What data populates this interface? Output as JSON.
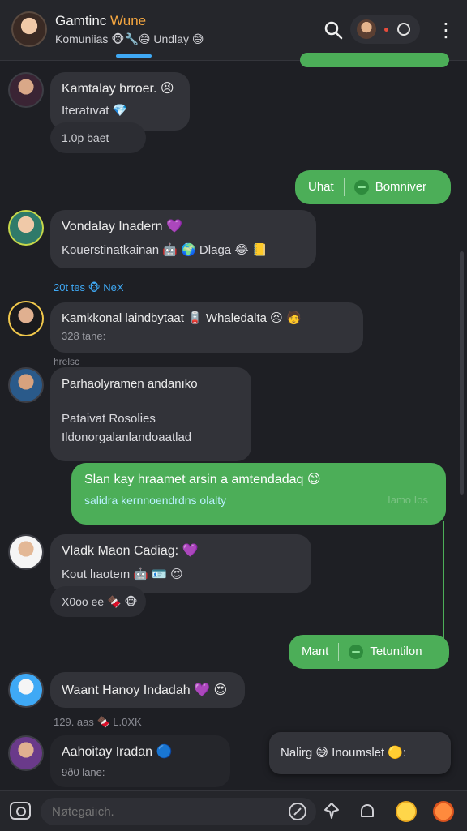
{
  "header": {
    "title_main": "Gamtinc ",
    "title_accent": "Wune",
    "subtitle": "Komuniias 🐵🔧😅 Undlay 😅",
    "icons": {
      "search": "search-icon",
      "menu": "more-vert-icon",
      "presence": "status-ring-icon"
    }
  },
  "messages": [
    {
      "name": "Kamtalay brroer. 😣",
      "line": "Iteratıvat 💎",
      "meta": "1.0p baet"
    },
    {
      "name": "Vondalay Inadern 💜",
      "line": "Kouerstinatkainan 🤖 🌍 Dlaga 😂 📒",
      "meta": "20t  tes  🐵 NeX"
    },
    {
      "name": "Kamkkonal laindbytaat 🪫 Whaledalta 😣 🧑",
      "line": "328 tane:",
      "meta": "hrelsc"
    },
    {
      "name": "Parhaolyramen andanıko",
      "line": "Pataivat Rosolies",
      "line2": "Ildonorgalanlandoaatlad"
    },
    {
      "name": "Vladk Maon Cadiag: 💜",
      "line": "Kout lıaoteın 🤖 🪪 😍",
      "meta": "X0oo ee 🍫 🐵"
    },
    {
      "name": "Waant Hanoy Indadah 💜 😍",
      "meta1": "129. aas  🍫 L.0XK"
    },
    {
      "name": "Aahoitay Iradan 🔵",
      "line": "9ð0 lane:"
    }
  ],
  "sent": [
    {
      "left": "Uhat",
      "right": "Bomniver"
    },
    {
      "main": "Slan kay hraamet arsin a amtendadaq 😊",
      "sub": "salidra kernnoendrdns olalty",
      "time": "Iamo Ios"
    },
    {
      "left": "Mant",
      "right": "Tetuntilon"
    }
  ],
  "reply_pill": {
    "text": "Nalirg 😅 Inoumslet 🟡:"
  },
  "composer": {
    "placeholder": "Nøtegaiıch.",
    "icons": [
      "camera-icon",
      "sticker-icon",
      "pin-icon",
      "bell-icon",
      "emoji-icon",
      "fire-icon"
    ]
  }
}
